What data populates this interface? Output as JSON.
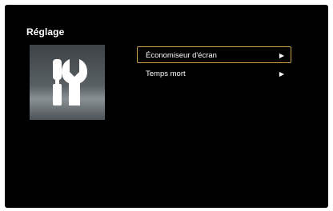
{
  "header": {
    "title": "Réglage"
  },
  "tile": {
    "icon": "tools-icon"
  },
  "menu": {
    "items": [
      {
        "label": "Économiseur d'écran",
        "arrow": "▶",
        "selected": true
      },
      {
        "label": "Temps mort",
        "arrow": "▶",
        "selected": false
      }
    ]
  },
  "colors": {
    "background": "#000000",
    "text": "#ffffff",
    "focus_border": "#c9a24a"
  }
}
